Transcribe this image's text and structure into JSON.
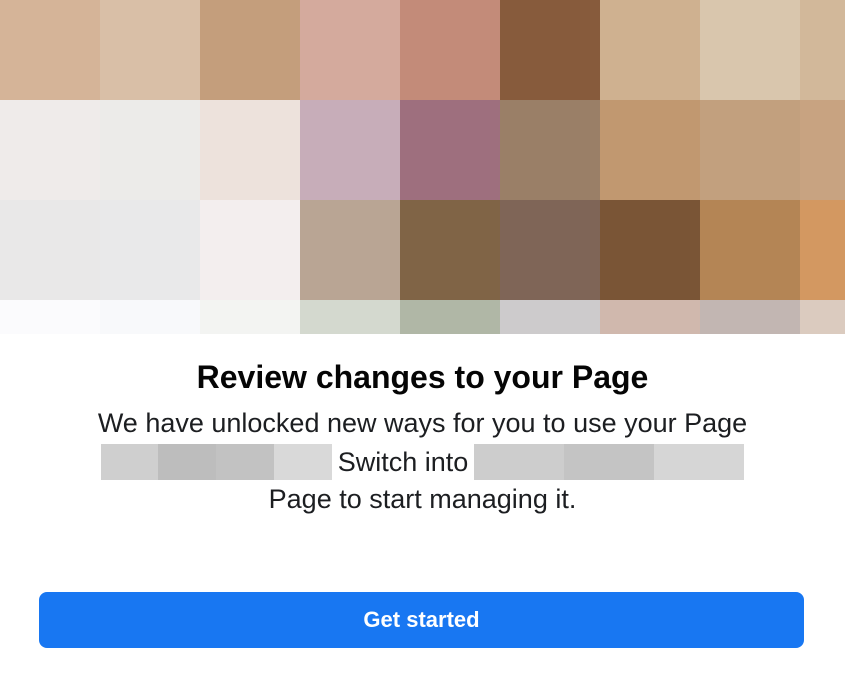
{
  "dialog": {
    "title": "Review changes to your Page",
    "message_line1": "We have unlocked new ways for you to use your Page",
    "message_line2_middle": "Switch into",
    "message_line3": "Page to start managing it.",
    "primary_button_label": "Get started"
  },
  "colors": {
    "primary_button": "#1877f2",
    "title_text": "#050505",
    "body_text": "#1c1e21",
    "background": "#ffffff"
  },
  "hero_pixel_colors": [
    [
      "#d5b498",
      "#d9bfa7",
      "#c49e7c",
      "#d4aa9d",
      "#c38b79",
      "#875b3c",
      "#cfb190",
      "#d9c6ad",
      "#d2b89a"
    ],
    [
      "#efebea",
      "#ecebe9",
      "#ede2dc",
      "#c7adb9",
      "#9e6f7e",
      "#9a7f67",
      "#c19870",
      "#c2a07e",
      "#c8a381"
    ],
    [
      "#e9e8e8",
      "#e9e9ea",
      "#f3eeee",
      "#b9a594",
      "#806446",
      "#7f6557",
      "#7a5536",
      "#b48555",
      "#d39861"
    ],
    [
      "#fbfbfd",
      "#f8f9fb",
      "#f3f4f2",
      "#d4d9cf",
      "#b0b7a6",
      "#cdcbcc",
      "#d0b8ad",
      "#c2b6b2",
      "#dbcbbf"
    ]
  ],
  "redacted_block_colors": {
    "line2_left": [
      "#cfcfcf",
      "#bdbdbd",
      "#c2c2c2",
      "#d9d9d9"
    ],
    "line2_right": [
      "#cdcdcd",
      "#c4c4c4",
      "#d6d6d6"
    ]
  }
}
